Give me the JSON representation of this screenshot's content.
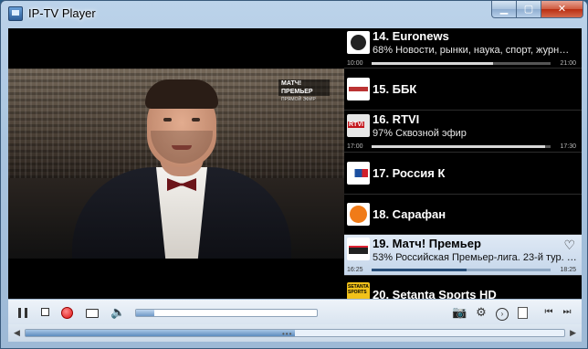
{
  "window": {
    "title": "IP-TV Player"
  },
  "video": {
    "overlay_logo": "МАТЧ! ПРЕМЬЕР",
    "overlay_sub": "ПРЯМОЙ ЭФИР"
  },
  "channels": [
    {
      "name": "14. Euronews",
      "program": "68% Новости, рынки, наука, спорт, журн…",
      "start": "10:00",
      "end": "21:00",
      "progress": 0.68,
      "logo": "euronews-logo"
    },
    {
      "name": "15. ББК",
      "logo": "bbk-logo"
    },
    {
      "name": "16. RTVI",
      "program": "97% Сквозной эфир",
      "start": "17:00",
      "end": "17:30",
      "progress": 0.97,
      "logo": "rtvi-logo"
    },
    {
      "name": "17. Россия К",
      "logo": "russia-k-logo"
    },
    {
      "name": "18. Сарафан",
      "logo": "sarafan-logo"
    },
    {
      "name": "19. Матч! Премьер",
      "program": "53% Российская Премьер-лига. 23-й тур. …",
      "start": "16:25",
      "end": "18:25",
      "progress": 0.53,
      "logo": "match-premier-logo",
      "selected": true
    },
    {
      "name": "20. Setanta Sports HD",
      "logo": "setanta-logo"
    }
  ],
  "controls": {
    "volume": 0.1,
    "seek": 0.5
  },
  "colors": {
    "selection": "#c5d6ea",
    "accent": "#5d8cbe"
  }
}
